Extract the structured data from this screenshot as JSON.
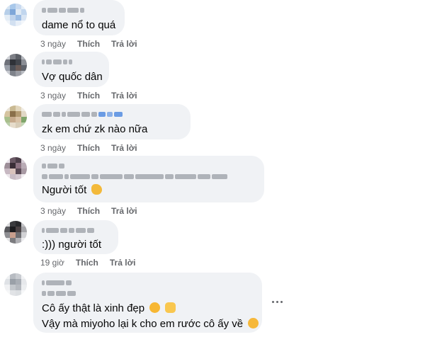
{
  "comments": [
    {
      "text": "dame nổ to quá",
      "time": "3 ngày",
      "like": "Thích",
      "reply": "Trả lời"
    },
    {
      "text": "Vợ quốc dân",
      "time": "3 ngày",
      "like": "Thích",
      "reply": "Trả lời"
    },
    {
      "text": "zk em chứ zk nào nữa",
      "time": "3 ngày",
      "like": "Thích",
      "reply": "Trả lời"
    },
    {
      "text": "Người tốt",
      "emoji": "ok-hand-emoji",
      "time": "3 ngày",
      "like": "Thích",
      "reply": "Trả lời"
    },
    {
      "text": ":))) người tốt",
      "time": "19 giờ",
      "like": "Thích",
      "reply": "Trả lời"
    },
    {
      "lines": [
        "Cô ấy thật là xinh đẹp",
        "Vậy mà miyoho lại k cho em rước cô ấy về"
      ],
      "emojis": [
        "smiling-face-emoji",
        "heart-hands-emoji",
        "crying-face-emoji"
      ]
    }
  ],
  "icons": {
    "more": "more-horizontal-icon"
  },
  "colors": {
    "bubble": "#f0f2f5",
    "meta": "#65676b",
    "text": "#050505"
  }
}
